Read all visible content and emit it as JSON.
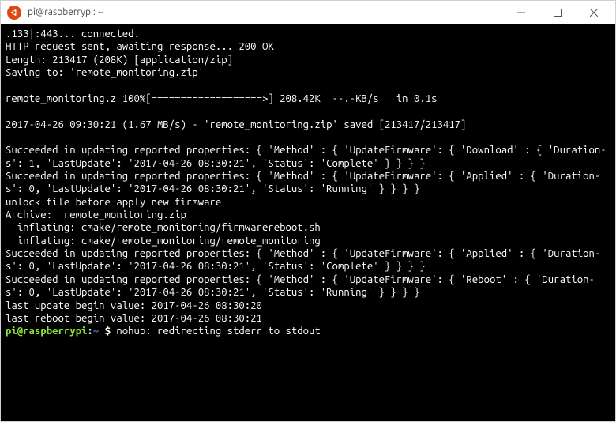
{
  "titlebar": {
    "title": "pi@raspberrypi: ~",
    "app_icon_name": "ubuntu-terminal-icon",
    "minimize_label": "Minimize",
    "maximize_label": "Maximize",
    "close_label": "Close"
  },
  "terminal": {
    "lines": [
      ".133|:443... connected.",
      "HTTP request sent, awaiting response... 200 OK",
      "Length: 213417 (208K) [application/zip]",
      "Saving to: 'remote_monitoring.zip'",
      "",
      "remote_monitoring.z 100%[===================>] 208.42K  --.-KB/s   in 0.1s",
      "",
      "2017-04-26 09:30:21 (1.67 MB/s) - 'remote_monitoring.zip' saved [213417/213417]",
      "",
      "Succeeded in updating reported properties: { 'Method' : { 'UpdateFirmware': { 'Download' : { 'Duration-s': 1, 'LastUpdate': '2017-04-26 08:30:21', 'Status': 'Complete' } } } }",
      "Succeeded in updating reported properties: { 'Method' : { 'UpdateFirmware': { 'Applied' : { 'Duration-s': 0, 'LastUpdate': '2017-04-26 08:30:21', 'Status': 'Running' } } } }",
      "unlock file before apply new firmware",
      "Archive:  remote_monitoring.zip",
      "  inflating: cmake/remote_monitoring/firmwarereboot.sh",
      "  inflating: cmake/remote_monitoring/remote_monitoring",
      "Succeeded in updating reported properties: { 'Method' : { 'UpdateFirmware': { 'Applied' : { 'Duration-s': 0, 'LastUpdate': '2017-04-26 08:30:21', 'Status': 'Complete' } } } }",
      "Succeeded in updating reported properties: { 'Method' : { 'UpdateFirmware': { 'Reboot' : { 'Duration-s': 0, 'LastUpdate': '2017-04-26 08:30:21', 'Status': 'Running' } } } }",
      "last update begin value: 2017-04-26 08:30:20",
      "last reboot begin value: 2017-04-26 08:30:21"
    ],
    "prompt": {
      "user_host": "pi@raspberrypi",
      "colon": ":",
      "path": "~ ",
      "dollar": "$",
      "tail": " nohup: redirecting stderr to stdout"
    }
  },
  "colors": {
    "ubuntu_orange": "#dd4814",
    "term_bg": "#000000",
    "term_fg": "#ffffff",
    "prompt_green": "#8ae234",
    "prompt_blue": "#3465a4"
  }
}
